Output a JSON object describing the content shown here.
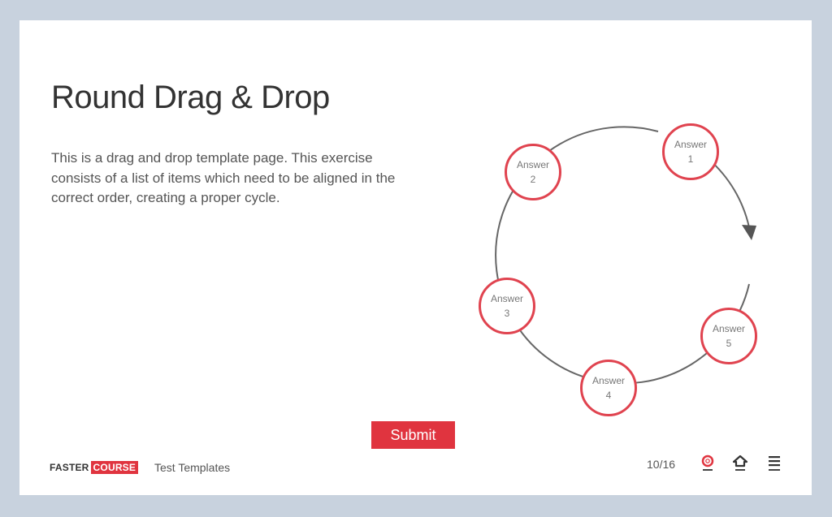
{
  "title": "Round Drag & Drop",
  "description": "This is a drag and drop template page. This exercise consists of a list of items which need to be aligned in the correct order, creating a proper cycle.",
  "answers": [
    {
      "label": "Answer",
      "number": "1"
    },
    {
      "label": "Answer",
      "number": "2"
    },
    {
      "label": "Answer",
      "number": "3"
    },
    {
      "label": "Answer",
      "number": "4"
    },
    {
      "label": "Answer",
      "number": "5"
    }
  ],
  "submit_label": "Submit",
  "footer": {
    "logo_part1": "FASTER",
    "logo_part2": "COURSE",
    "course_name": "Test Templates",
    "page_counter": "10/16",
    "icons": [
      "lifebuoy-icon",
      "home-icon",
      "menu-icon"
    ]
  },
  "colors": {
    "accent": "#e0343f",
    "background": "#c8d2de",
    "card": "#ffffff",
    "cycle_line": "#666666"
  }
}
